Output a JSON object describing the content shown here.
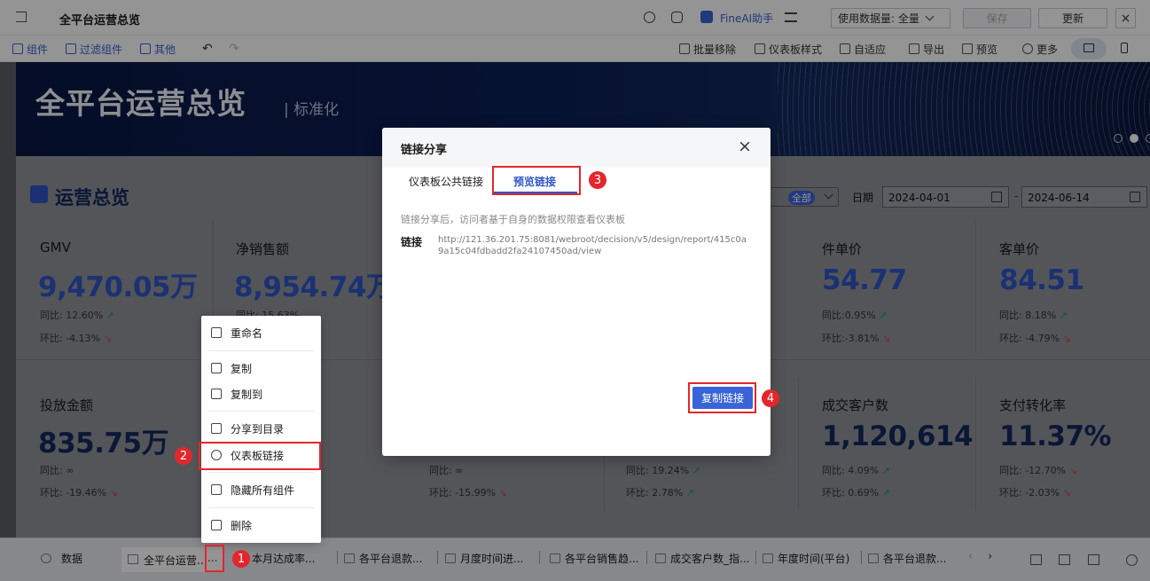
{
  "topbar": {
    "title": "全平台运营总览",
    "fineai": "FineAI助手",
    "data_label": "使用数据量: 全量",
    "save": "保存",
    "refresh": "更新"
  },
  "toolbar": {
    "component": "组件",
    "filter_component": "过滤组件",
    "other": "其他",
    "batch_remove": "批量移除",
    "dashboard_style": "仪表板样式",
    "adaptive": "自适应",
    "export": "导出",
    "preview": "预览",
    "more": "更多"
  },
  "banner": {
    "title": "全平台运营总览",
    "subtitle": "| 标准化"
  },
  "section": {
    "title": "运营总览",
    "all_select": "全部",
    "date_label": "日期",
    "date_start": "2024-04-01",
    "date_sep": "-",
    "date_end": "2024-06-14"
  },
  "kpis_row1": [
    {
      "title": "GMV",
      "value": "9,470.05万",
      "yoy": "同比: 12.60%",
      "mom": "环比: -4.13%"
    },
    {
      "title": "净销售额",
      "value": "8,954.74万",
      "yoy": "同比: 15.63%",
      "mom": ""
    },
    {
      "title": "件单价",
      "value": "54.77",
      "yoy": "同比:0.95%",
      "mom": "环比:-3.81%"
    },
    {
      "title": "客单价",
      "value": "84.51",
      "yoy": "同比: 8.18%",
      "mom": "环比: -4.79%"
    }
  ],
  "kpis_row2": [
    {
      "title": "投放金额",
      "value": "835.75万",
      "yoy": "同比: ∞",
      "mom": "环比: -19.46%"
    },
    {
      "title": "",
      "value": "",
      "yoy": "同比: ∞",
      "mom": "环比: -15.99%"
    },
    {
      "title": "",
      "value": "",
      "yoy": "同比: 19.24%",
      "mom": "环比: 2.78%"
    },
    {
      "title": "成交客户数",
      "value": "1,120,614",
      "yoy": "同比: 4.09%",
      "mom": "环比: 0.69%"
    },
    {
      "title": "支付转化率",
      "value": "11.37%",
      "yoy": "同比: -12.70%",
      "mom": "环比: -2.03%"
    }
  ],
  "context_menu": {
    "rename": "重命名",
    "copy": "复制",
    "copy_to": "复制到",
    "share_to_dir": "分享到目录",
    "dashboard_link": "仪表板链接",
    "hide_all": "隐藏所有组件",
    "delete": "删除"
  },
  "dialog": {
    "title": "链接分享",
    "tab_public": "仪表板公共链接",
    "tab_preview": "预览链接",
    "note": "链接分享后，访问者基于自身的数据权限查看仪表板",
    "link_label": "链接",
    "link_line1": "http://121.36.201.75:8081/webroot/decision/v5/design/report/415c0a",
    "link_line2": "9a15c04fdbadd2fa24107450ad/view",
    "copy_button": "复制链接"
  },
  "bottombar": {
    "data": "数据",
    "tabs": [
      "全平台运营..",
      "本月达成率...",
      "各平台退款...",
      "月度时间进...",
      "各平台销售趋...",
      "成交客户数_指...",
      "年度时间(平台)",
      "各平台退款..."
    ],
    "more": "..."
  },
  "badges": [
    "1",
    "2",
    "3",
    "4"
  ],
  "colors": {
    "accent": "#3a63d8",
    "kpi_blue": "#2f55c9",
    "kpi_navy": "#13285e",
    "red": "#e3262c",
    "up": "#1c9a5a",
    "down": "#d83b3b"
  }
}
